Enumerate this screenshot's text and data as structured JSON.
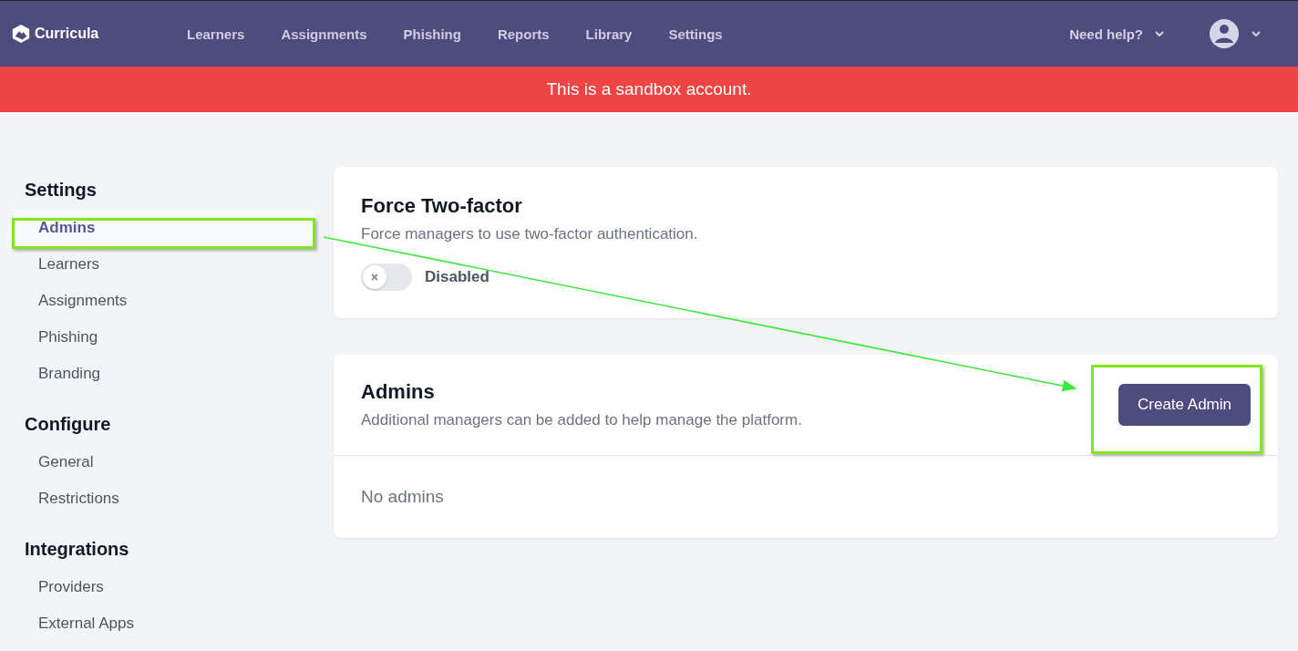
{
  "brand": "Curricula",
  "nav": [
    {
      "label": "Learners",
      "selected": false
    },
    {
      "label": "Assignments",
      "selected": false
    },
    {
      "label": "Phishing",
      "selected": false
    },
    {
      "label": "Reports",
      "selected": false
    },
    {
      "label": "Library",
      "selected": false
    },
    {
      "label": "Settings",
      "selected": false
    }
  ],
  "help": "Need help?",
  "banner": "This is a sandbox account.",
  "sidebar": [
    {
      "heading": "Settings",
      "items": [
        {
          "label": "Admins",
          "selected": true
        },
        {
          "label": "Learners",
          "selected": false
        },
        {
          "label": "Assignments",
          "selected": false
        },
        {
          "label": "Phishing",
          "selected": false
        },
        {
          "label": "Branding",
          "selected": false
        }
      ]
    },
    {
      "heading": "Configure",
      "items": [
        {
          "label": "General",
          "selected": false
        },
        {
          "label": "Restrictions",
          "selected": false
        }
      ]
    },
    {
      "heading": "Integrations",
      "items": [
        {
          "label": "Providers",
          "selected": false
        },
        {
          "label": "External Apps",
          "selected": false
        }
      ]
    }
  ],
  "two_factor": {
    "title": "Force Two-factor",
    "description": "Force managers to use two-factor authentication.",
    "on": false,
    "state_label": "Disabled"
  },
  "admins": {
    "title": "Admins",
    "description": "Additional managers can be added to help manage the platform.",
    "button": "Create Admin",
    "empty": "No admins"
  }
}
